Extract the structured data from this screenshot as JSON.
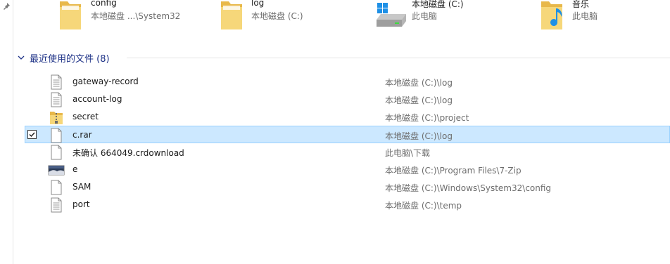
{
  "quick_access": [
    {
      "name": "config",
      "path": "本地磁盘 ...\\System32",
      "icon": "folder-icon"
    },
    {
      "name": "log",
      "path": "本地磁盘 (C:)",
      "icon": "folder-icon"
    },
    {
      "name": "本地磁盘 (C:)",
      "path": "此电脑",
      "icon": "drive-icon"
    },
    {
      "name": "音乐",
      "path": "此电脑",
      "icon": "music-folder-icon"
    }
  ],
  "recent": {
    "title": "最近使用的文件 (8)",
    "files": [
      {
        "name": "gateway-record",
        "path": "本地磁盘 (C:)\\log",
        "icon": "text-file-icon",
        "selected": false
      },
      {
        "name": "account-log",
        "path": "本地磁盘 (C:)\\log",
        "icon": "text-file-icon",
        "selected": false
      },
      {
        "name": "secret",
        "path": "本地磁盘 (C:)\\project",
        "icon": "zip-folder-icon",
        "selected": false
      },
      {
        "name": "c.rar",
        "path": "本地磁盘 (C:)\\log",
        "icon": "blank-file-icon",
        "selected": true
      },
      {
        "name": "未确认 664049.crdownload",
        "path": "此电脑\\下载",
        "icon": "blank-file-icon",
        "selected": false
      },
      {
        "name": "e",
        "path": "本地磁盘 (C:)\\Program Files\\7-Zip",
        "icon": "image-file-icon",
        "selected": false
      },
      {
        "name": "SAM",
        "path": "本地磁盘 (C:)\\Windows\\System32\\config",
        "icon": "blank-file-icon",
        "selected": false
      },
      {
        "name": "port",
        "path": "本地磁盘 (C:)\\temp",
        "icon": "text-file-icon",
        "selected": false
      }
    ]
  },
  "colors": {
    "selection_bg": "#cce8ff",
    "selection_border": "#99d1ff",
    "section_title": "#1e3287",
    "folder": "#f3d06a"
  }
}
